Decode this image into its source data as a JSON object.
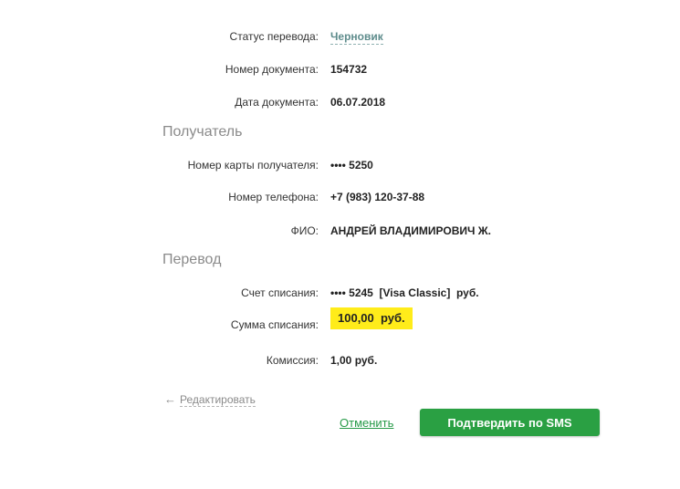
{
  "document": {
    "status_label": "Статус перевода:",
    "status_value": "Черновик",
    "number_label": "Номер документа:",
    "number_value": "154732",
    "date_label": "Дата документа:",
    "date_value": "06.07.2018"
  },
  "recipient": {
    "section_title": "Получатель",
    "card_label": "Номер карты получателя:",
    "card_value": "•••• 5250",
    "phone_label": "Номер телефона:",
    "phone_value": "+7 (983) 120-37-88",
    "name_label": "ФИО:",
    "name_value": "АНДРЕЙ ВЛАДИМИРОВИЧ Ж."
  },
  "transfer": {
    "section_title": "Перевод",
    "account_label": "Счет списания:",
    "account_value": "•••• 5245  [Visa Classic]  руб.",
    "amount_label": "Сумма списания:",
    "amount_value": "100,00  руб.",
    "fee_label": "Комиссия:",
    "fee_value": "1,00 руб."
  },
  "actions": {
    "edit_arrow": "←",
    "edit_label": "Редактировать",
    "cancel_label": "Отменить",
    "confirm_label": "Подтвердить по SMS"
  },
  "colors": {
    "accent_green": "#2aa043",
    "highlight_yellow": "#ffec1a",
    "status_teal": "#5e8c8c"
  }
}
